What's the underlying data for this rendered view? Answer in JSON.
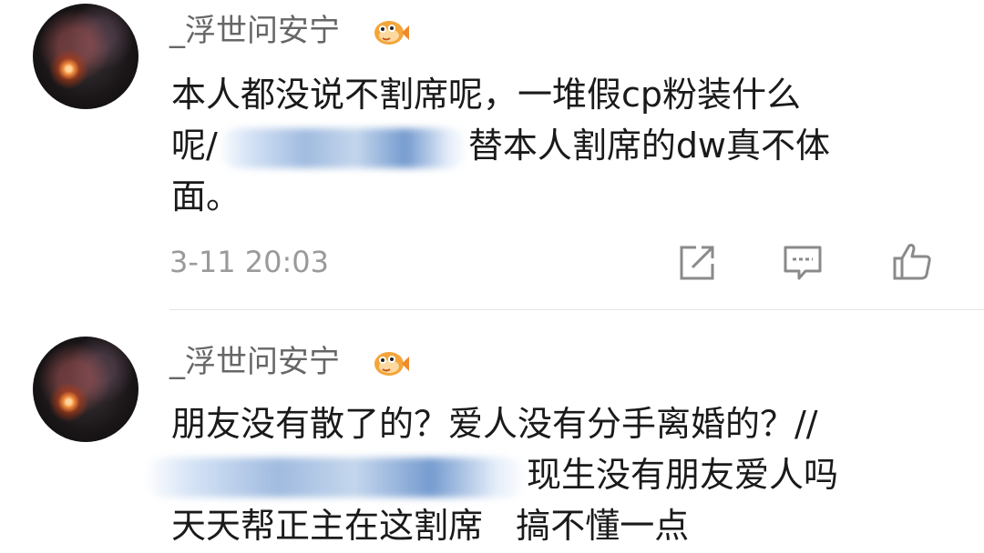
{
  "comments": [
    {
      "username": "_浮世问安宁",
      "lines": [
        {
          "before": "本人都没说不割席呢，一堆假cp粉装什么",
          "after": ""
        },
        {
          "before": "呢/",
          "after": "替本人割席的dw真不体"
        },
        {
          "before": "面。",
          "after": ""
        }
      ],
      "timestamp": "3-11 20:03",
      "actions": [
        "share-icon",
        "comment-icon",
        "like-icon"
      ]
    },
    {
      "username": "_浮世问安宁",
      "lines": [
        {
          "before": "朋友没有散了的？爱人没有分手离婚的？//",
          "after": ""
        },
        {
          "before": "",
          "after": "现生没有朋友爱人吗"
        },
        {
          "before": "天天帮正主在这割席   搞不懂一点",
          "after": ""
        }
      ]
    }
  ],
  "colors": {
    "text": "#1a1a1a",
    "meta": "#9a9a9a",
    "username": "#666666",
    "icon": "#8a8a8a"
  },
  "badge_icon": "fish-emoji-icon"
}
